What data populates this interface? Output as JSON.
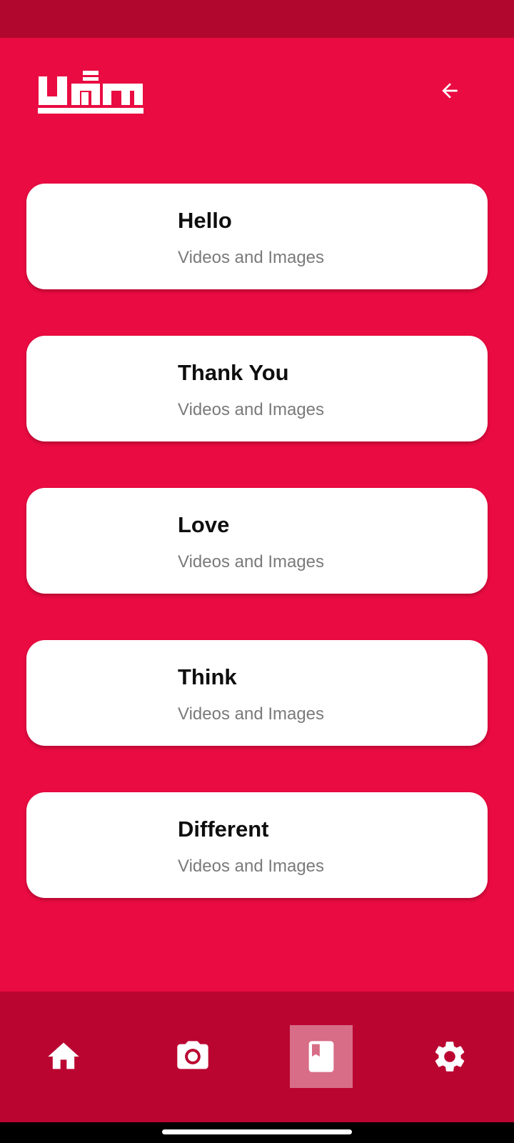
{
  "header": {
    "logo_name": "app-logo",
    "back_icon": "arrow-back-icon"
  },
  "categories": [
    {
      "title": "Hello",
      "subtitle": "Videos and Images"
    },
    {
      "title": "Thank You",
      "subtitle": "Videos and Images"
    },
    {
      "title": "Love",
      "subtitle": "Videos and Images"
    },
    {
      "title": "Think",
      "subtitle": "Videos and Images"
    },
    {
      "title": "Different",
      "subtitle": "Videos and Images"
    }
  ],
  "bottom_nav": {
    "items": [
      {
        "icon": "home-icon",
        "active": false
      },
      {
        "icon": "camera-icon",
        "active": false
      },
      {
        "icon": "book-icon",
        "active": true
      },
      {
        "icon": "settings-icon",
        "active": false
      }
    ]
  },
  "colors": {
    "background": "#e90b41",
    "status_bar": "#b1072e",
    "bottom_nav": "#ba0531",
    "card": "#ffffff",
    "title_text": "#0e0e0e",
    "subtitle_text": "#7a7a7a"
  }
}
